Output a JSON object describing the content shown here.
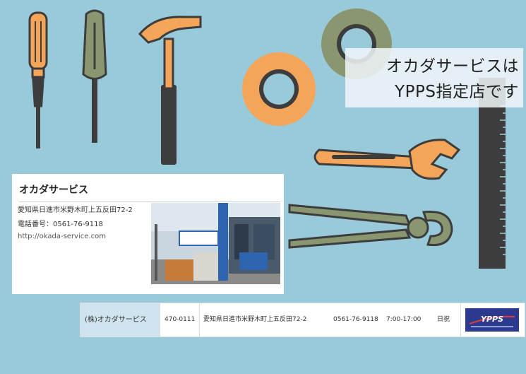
{
  "headline": {
    "line1": "オカダサービスは",
    "line2": "YPPS指定店です"
  },
  "shop_card": {
    "title": "オカダサービス",
    "address": "愛知県日進市米野木町上五反田72-2",
    "phone": "電話番号：0561-76-9118",
    "url": "http://okada-service.com"
  },
  "shop_table": {
    "name": "(株)オカダサービス",
    "postal": "470-0111",
    "address": "愛知県日進市米野木町上五反田72-2",
    "phone": "0561-76-9118",
    "hours": "7:00-17:00",
    "closed": "日祝",
    "logo_text": "YPPS"
  },
  "colors": {
    "background": "#99cad9",
    "orange": "#f5a55a",
    "olive": "#8a9670",
    "dark": "#3d3d3d",
    "ypps_blue": "#2b3a8f"
  },
  "icons": [
    "screwdriver-orange-icon",
    "screwdriver-green-icon",
    "hammer-icon",
    "tape-roll-orange-icon",
    "tape-roll-olive-icon",
    "ruler-icon",
    "wrench-icon",
    "pliers-icon"
  ]
}
